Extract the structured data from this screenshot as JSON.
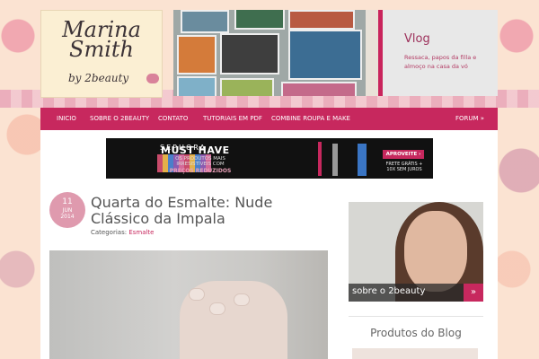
{
  "logo": {
    "name_line1": "Marina",
    "name_line2": "Smith",
    "by": "by 2beauty"
  },
  "vlog": {
    "title": "Vlog",
    "text": "Ressaca, papos da filla e almoço na casa da vó"
  },
  "nav": {
    "items": [
      "INICIO",
      "SOBRE O 2BEAUTY",
      "CONTATO",
      "TUTORIAIS EM PDF",
      "COMBINE ROUPA E MAKE"
    ],
    "forum": "FORUM »"
  },
  "banner": {
    "brand": "SEPHORA",
    "headline": "MUST HAVE",
    "subline": "OS PRODUTOS MAIS IRRESISTÍVEIS COM",
    "promo": "PREÇOS REDUZIDOS",
    "cta": "APROVEITE ›",
    "shipping": "FRETE GRÁTIS + 10X SEM JUROS"
  },
  "post": {
    "date": {
      "day": "11",
      "month": "JUN",
      "year": "2014"
    },
    "title": "Quarta do Esmalte: Nude Clássico da Impala",
    "categories_label": "Categorias:",
    "category": "Esmalte"
  },
  "sidebar": {
    "about_label": "sobre o 2beauty",
    "about_btn": "»",
    "produtos_title": "Produtos do Blog"
  },
  "colors": {
    "accent": "#c7285e",
    "date_badge": "#df9aae",
    "logo_bg": "#fbefd3"
  }
}
